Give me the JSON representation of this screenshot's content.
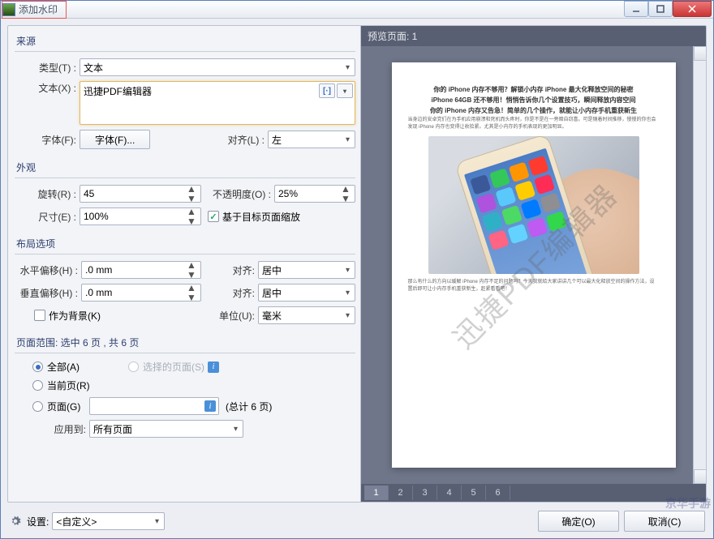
{
  "window": {
    "title": "添加水印"
  },
  "source": {
    "title": "来源",
    "type_label": "类型(T) :",
    "type_value": "文本",
    "text_label": "文本(X) :",
    "text_value": "迅捷PDF编辑器",
    "font_label": "字体(F):",
    "font_button": "字体(F)...",
    "align_label": "对齐(L) :",
    "align_value": "左"
  },
  "appearance": {
    "title": "外观",
    "rotate_label": "旋转(R) :",
    "rotate_value": "45",
    "opacity_label": "不透明度(O) :",
    "opacity_value": "25%",
    "size_label": "尺寸(E) :",
    "size_value": "100%",
    "scale_chk": "基于目标页面缩放"
  },
  "layout": {
    "title": "布局选项",
    "hoffset_label": "水平偏移(H) :",
    "hoffset_value": ".0 mm",
    "voffset_label": "垂直偏移(H) :",
    "voffset_value": ".0 mm",
    "halign_label": "对齐:",
    "halign_value": "居中",
    "valign_label": "对齐:",
    "valign_value": "居中",
    "bg_chk": "作为背景(K)",
    "unit_label": "单位(U):",
    "unit_value": "毫米"
  },
  "pagerange": {
    "title": "页面范围: 选中 6 页 , 共 6 页",
    "all": "全部(A)",
    "selected": "选择的页面(S)",
    "current": "当前页(R)",
    "pages": "页面(G)",
    "total": "(总计 6 页)",
    "apply_label": "应用到:",
    "apply_value": "所有页面"
  },
  "preview": {
    "title": "预览页面: 1",
    "watermark_text": "迅捷PDF编辑器",
    "doc_h1": "你的 iPhone 内存不够用？解锁小内存 iPhone 最大化释放空间的秘密",
    "doc_h2": "iPhone 64GB 还不够用！悄悄告诉你几个设置技巧，瞬间释放内容空间",
    "doc_h3": "你的 iPhone 内存又告急！简单的几个操作，就能让小内存手机重获新生",
    "doc_p1": "当身边的安卓党们在为手机应用崩溃和死机而头疼时，你是不是在一旁暗自窃喜。可是随着时间推移，慢慢的你也会发现 iPhone 内存也变得让收拾紧。尤其是小内存的手机表现的更加明显。",
    "doc_p2": "那么有什么的方向以缓解 iPhone 内存不足的问题吗？今天我就给大家讲讲几个可以最大化释放空间的操作方法，设置后即可让小内存手机重获新生，赶紧看看吧！",
    "thumbs": [
      "1",
      "2",
      "3",
      "4",
      "5",
      "6"
    ]
  },
  "footer": {
    "settings_label": "设置:",
    "settings_value": "<自定义>",
    "ok": "确定(O)",
    "cancel": "取消(C)"
  },
  "corner_watermark": "京华手游"
}
